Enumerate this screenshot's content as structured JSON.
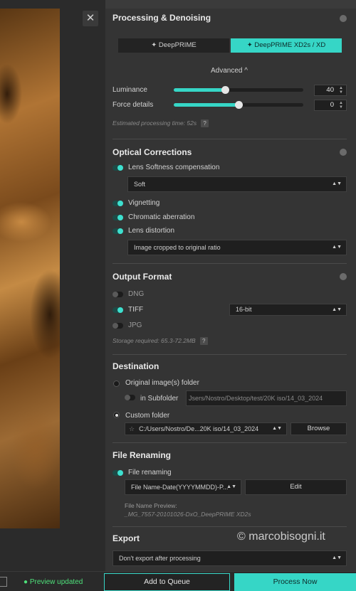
{
  "close_glyph": "✕",
  "sections": {
    "processing": {
      "title": "Processing & Denoising",
      "btn_deepprime": "✦ DeepPRIME",
      "btn_xd": "✦ DeepPRIME XD2s / XD",
      "advanced": "Advanced ^",
      "luminance_label": "Luminance",
      "luminance_value": "40",
      "luminance_fraction": 0.4,
      "force_details_label": "Force details",
      "force_details_value": "0",
      "force_details_fraction": 0.5,
      "estimated_time": "Estimated processing time:  52s",
      "help_q": "?"
    },
    "optical": {
      "title": "Optical Corrections",
      "lens_softness": "Lens Softness compensation",
      "softness_select": "Soft",
      "vignetting": "Vignetting",
      "chromatic": "Chromatic aberration",
      "distortion": "Lens distortion",
      "distortion_select": "Image cropped to original ratio"
    },
    "output": {
      "title": "Output Format",
      "dng": "DNG",
      "tiff": "TIFF",
      "tiff_depth": "16-bit",
      "jpg": "JPG",
      "storage": "Storage required: 65.3-72.2MB",
      "help_q": "?"
    },
    "destination": {
      "title": "Destination",
      "original_folder": "Original image(s) folder",
      "in_subfolder": "in Subfolder",
      "subfolder_path": "Jsers/Nostro/Desktop/test/20K iso/14_03_2024",
      "custom_folder": "Custom folder",
      "custom_path": "C:/Users/Nostro/De...20K iso/14_03_2024",
      "browse": "Browse"
    },
    "renaming": {
      "title": "File Renaming",
      "toggle_label": "File renaming",
      "pattern": "File Name-Date(YYYYMMDD)-P...",
      "edit": "Edit",
      "preview_label": "File Name Preview:",
      "preview_value": "_MG_7557-20101026-DxO_DeepPRIME XD2s"
    },
    "export": {
      "title": "Export",
      "select": "Don't export after processing"
    }
  },
  "bottom": {
    "status": "● Preview updated",
    "add_to_queue": "Add to Queue",
    "process_now": "Process Now"
  },
  "watermark": "© marcobisogni.it",
  "colors": {
    "accent": "#36d6c6",
    "status_green": "#4ee07a",
    "panel": "#343434"
  }
}
